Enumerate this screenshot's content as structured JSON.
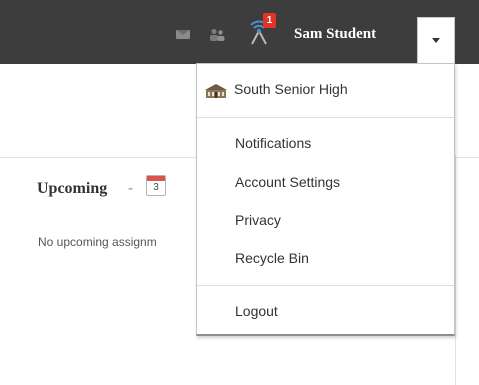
{
  "topbar": {
    "user_name": "Sam Student",
    "notification_count": "1",
    "icons": [
      "mail-icon",
      "people-icon",
      "notifications-icon",
      "chevron-down-icon"
    ]
  },
  "page": {
    "upcoming": {
      "title": "Upcoming",
      "separator": "-",
      "calendar_day": "3",
      "empty_text": "No upcoming assignm"
    }
  },
  "dropdown": {
    "school": "South Senior High",
    "items": [
      "Notifications",
      "Account Settings",
      "Privacy",
      "Recycle Bin"
    ],
    "logout": "Logout"
  },
  "colors": {
    "topbar": "#3d3d3d",
    "badge": "#e0332a"
  }
}
